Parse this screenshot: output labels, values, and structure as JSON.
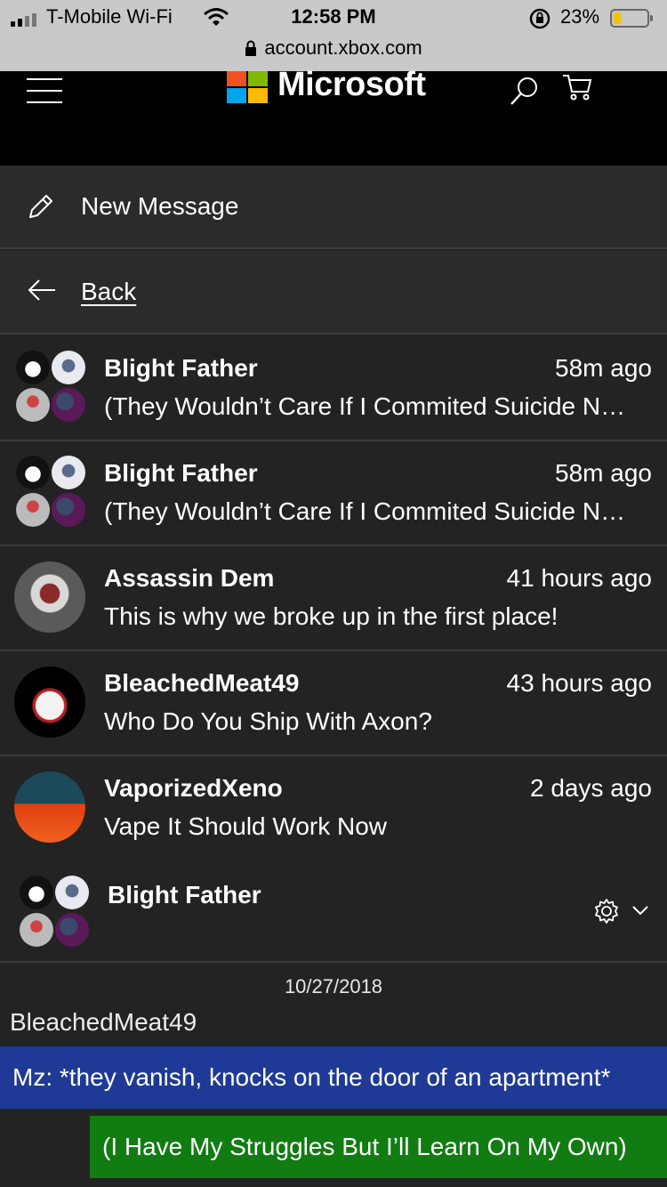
{
  "status_bar": {
    "carrier": "T-Mobile Wi-Fi",
    "time": "12:58 PM",
    "battery_percent": "23%",
    "battery_level": 0.23,
    "url": "account.xbox.com"
  },
  "header": {
    "brand": "Microsoft",
    "logo_colors": [
      "#f25022",
      "#7fba00",
      "#00a4ef",
      "#ffb900"
    ]
  },
  "actions": {
    "new_message": "New Message",
    "back": "Back"
  },
  "conversations": [
    {
      "name": "Blight Father",
      "time": "58m ago",
      "preview": "(They Wouldn’t Care If I Commited Suicide N…",
      "avatar": "group"
    },
    {
      "name": "Blight Father",
      "time": "58m ago",
      "preview": "(They Wouldn’t Care If I Commited Suicide N…",
      "avatar": "group"
    },
    {
      "name": "Assassin Dem",
      "time": "41 hours ago",
      "preview": "This is why we broke up in the first place!",
      "avatar": "assassin"
    },
    {
      "name": "BleachedMeat49",
      "time": "43 hours ago",
      "preview": "Who Do You Ship With Axon?",
      "avatar": "demon"
    },
    {
      "name": "VaporizedXeno",
      "time": "2 days ago",
      "preview": "Vape It Should Work Now",
      "avatar": "cobra"
    }
  ],
  "thread": {
    "name": "Blight Father",
    "date": "10/27/2018",
    "sender": "BleachedMeat49",
    "incoming_message": "Mz: *they vanish, knocks on the door of an apartment*",
    "outgoing_message": "(I Have My Struggles But I’ll Learn On My Own)"
  },
  "colors": {
    "incoming_bubble": "#1e3a96",
    "outgoing_bubble": "#117c11",
    "background": "#232323"
  }
}
